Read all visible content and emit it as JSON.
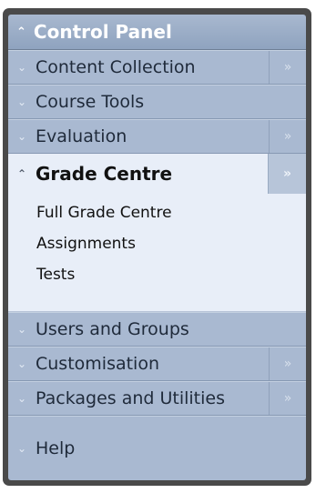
{
  "panel": {
    "title": "Control Panel",
    "title_icon": "chevron-up-double-icon",
    "items": [
      {
        "label": "Content Collection",
        "has_expander": true
      },
      {
        "label": "Course Tools",
        "has_expander": false
      },
      {
        "label": "Evaluation",
        "has_expander": true
      }
    ],
    "open_section": {
      "label": "Grade Centre",
      "subitems": [
        "Full Grade Centre",
        "Assignments",
        "Tests"
      ]
    },
    "items_after": [
      {
        "label": "Users and Groups",
        "has_expander": false
      },
      {
        "label": "Customisation",
        "has_expander": true
      },
      {
        "label": "Packages and Utilities",
        "has_expander": true
      },
      {
        "label": "Help",
        "has_expander": false
      }
    ]
  },
  "glyphs": {
    "collapsed": "»",
    "expanded": "«",
    "expander": "»"
  },
  "colors": {
    "header_bg": "#9aaec8",
    "item_bg": "#a9b9d1",
    "open_bg": "#e8eef8",
    "frame": "#4a4a4a"
  }
}
